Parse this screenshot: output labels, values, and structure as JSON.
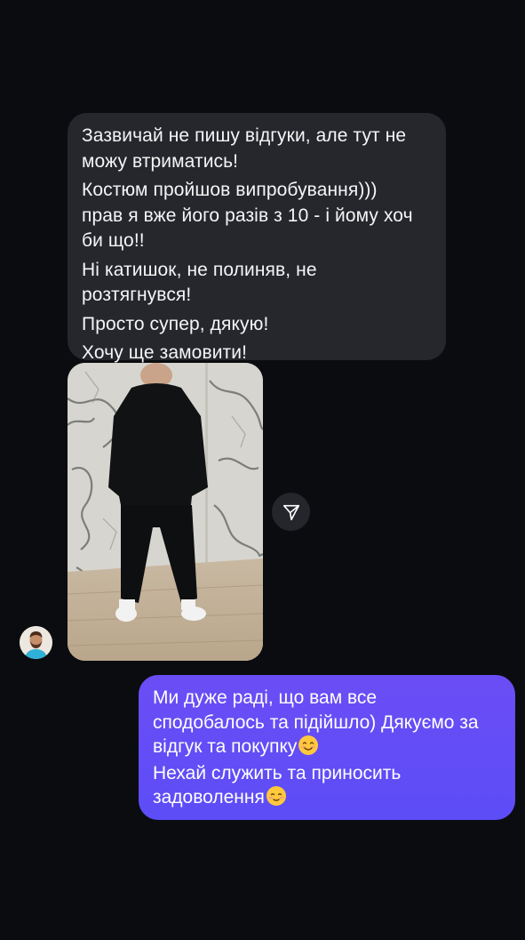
{
  "incoming_message": {
    "paragraphs": [
      [
        "Зазвичай не пишу відгуки, але тут не",
        "можу втриматись!"
      ],
      [
        "Костюм пройшов випробування)))",
        "прав я вже його разів з 10 - і йому хоч",
        "би що!!"
      ],
      [
        "Ні катишок, не полиняв, не",
        "розтягнувся!"
      ],
      [
        "Просто супер, дякую!"
      ],
      [
        "Хочу ще замовити!"
      ]
    ]
  },
  "outgoing_message": {
    "line1": "Ми дуже раді, що вам все",
    "line2": "сподобалось та підійшло) Дякуємо за",
    "line3": "відгук та покупку",
    "line3_emoji": "smiling-face-with-smiling-eyes-emoji",
    "line4": "Нехай служить та приносить",
    "line5": "задоволення",
    "line5_emoji": "smiling-face-emoji"
  },
  "icons": {
    "share": "paper-plane-icon",
    "avatar": "user-avatar"
  },
  "colors": {
    "background": "#0b0c10",
    "incoming_bubble": "#26272c",
    "outgoing_bubble": "#5c4df7",
    "share_button": "#24262b"
  }
}
